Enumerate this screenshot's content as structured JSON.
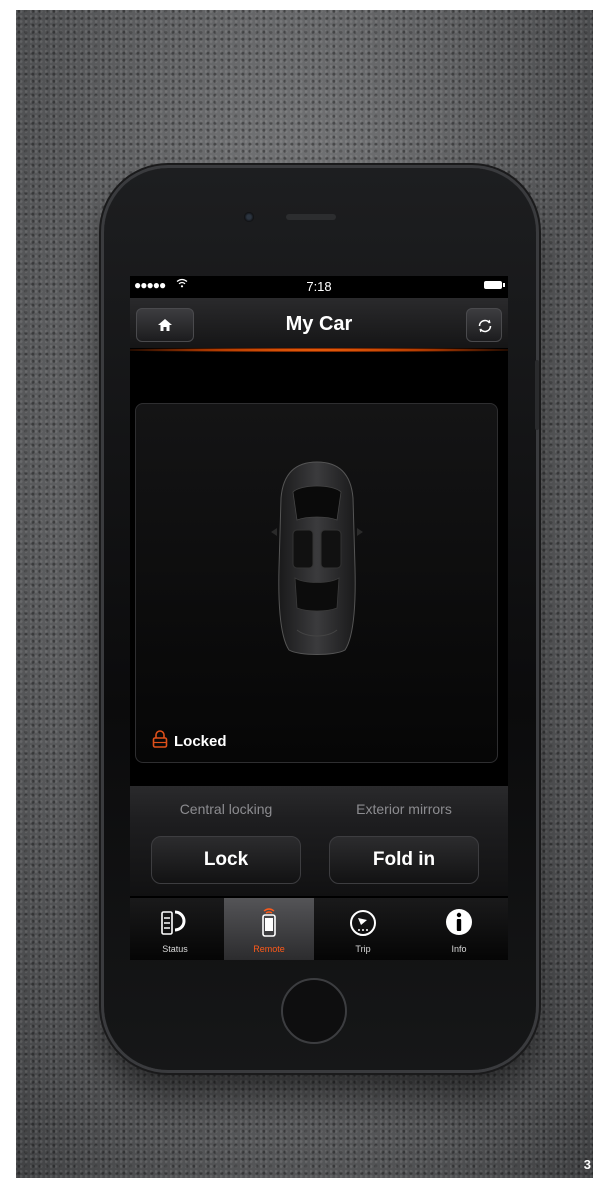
{
  "status_bar": {
    "signal": "●●●●●",
    "wifi": "wifi-icon",
    "time": "7:18",
    "battery": "battery-icon"
  },
  "nav": {
    "title": "My Car",
    "home_icon": "home-icon",
    "refresh_icon": "refresh-icon"
  },
  "car_panel": {
    "lock_state": "Locked",
    "lock_icon": "lock-icon",
    "accent": "#e0501a"
  },
  "controls": {
    "central_locking": {
      "header": "Central locking",
      "button": "Lock"
    },
    "exterior_mirrors": {
      "header": "Exterior mirrors",
      "button": "Fold in"
    }
  },
  "tabs": [
    {
      "label": "Status",
      "icon": "status-icon",
      "active": false
    },
    {
      "label": "Remote",
      "icon": "remote-icon",
      "active": true
    },
    {
      "label": "Trip",
      "icon": "trip-icon",
      "active": false
    },
    {
      "label": "Info",
      "icon": "info-icon",
      "active": false
    }
  ],
  "page_number": "3",
  "colors": {
    "accent": "#ff6a10",
    "background": "#000000"
  }
}
